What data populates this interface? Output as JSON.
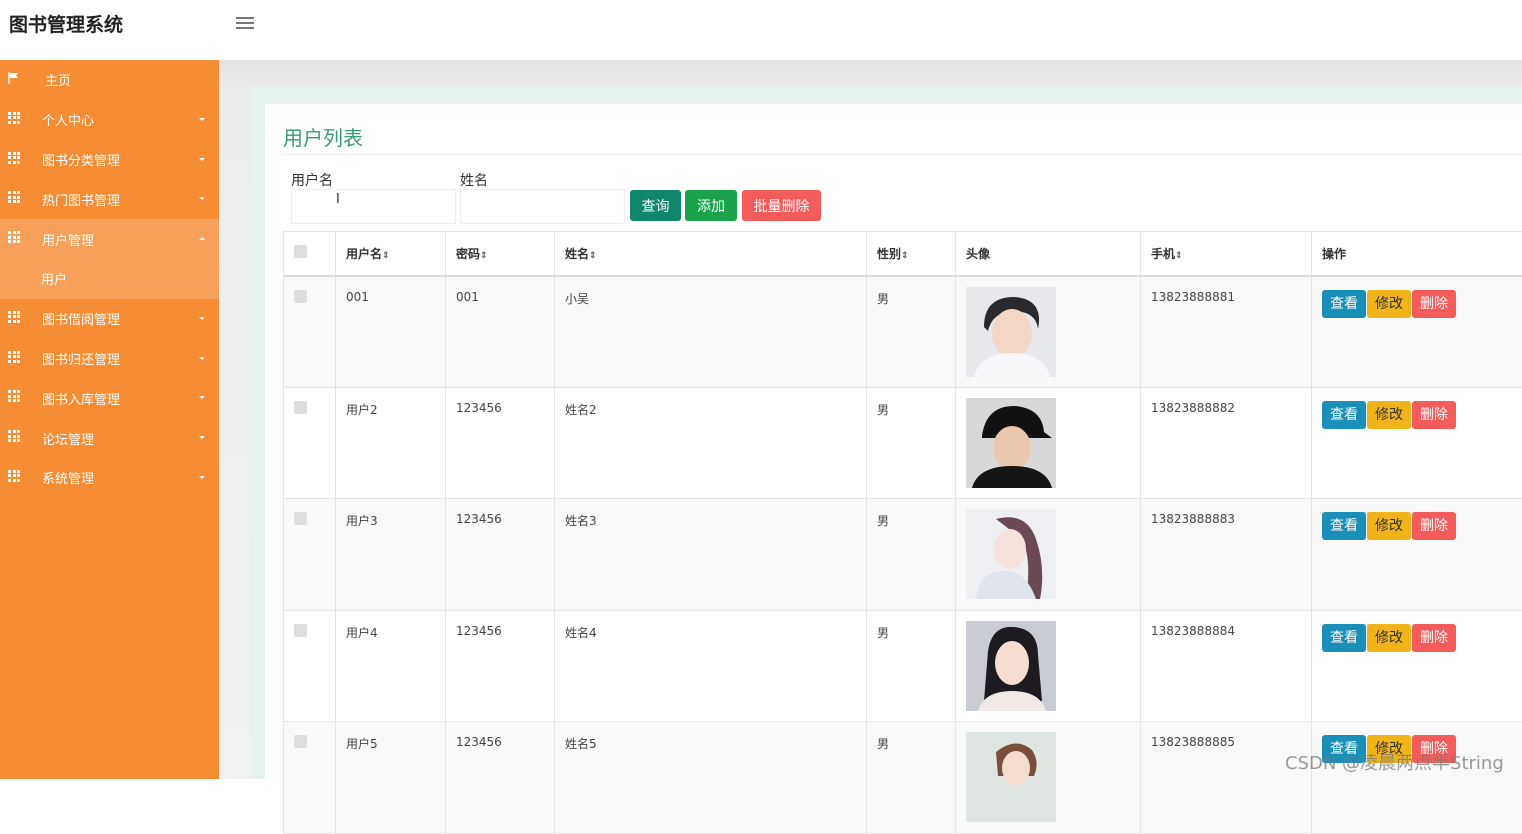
{
  "app": {
    "title": "图书管理系统"
  },
  "sidebar": {
    "items": [
      {
        "label": "主页",
        "icon": "flag-icon"
      },
      {
        "label": "个人中心",
        "icon": "grid-icon"
      },
      {
        "label": "图书分类管理",
        "icon": "grid-icon"
      },
      {
        "label": "热门图书管理",
        "icon": "grid-icon"
      },
      {
        "label": "用户管理",
        "icon": "grid-icon",
        "expanded": true
      },
      {
        "label": "图书借阅管理",
        "icon": "grid-icon"
      },
      {
        "label": "图书归还管理",
        "icon": "grid-icon"
      },
      {
        "label": "图书入库管理",
        "icon": "grid-icon"
      },
      {
        "label": "论坛管理",
        "icon": "grid-icon"
      },
      {
        "label": "系统管理",
        "icon": "grid-icon"
      }
    ],
    "sub_item": "用户"
  },
  "page": {
    "title": "用户列表"
  },
  "search": {
    "username_label": "用户名",
    "username_value": "",
    "name_label": "姓名",
    "name_value": "",
    "query_label": "查询",
    "add_label": "添加",
    "batch_delete_label": "批量删除"
  },
  "table": {
    "headers": [
      "用户名",
      "密码",
      "姓名",
      "性别",
      "头像",
      "手机",
      "操作"
    ],
    "rows": [
      {
        "username": "001",
        "password": "001",
        "name": "小吴",
        "gender": "男",
        "phone": "13823888881"
      },
      {
        "username": "用户2",
        "password": "123456",
        "name": "姓名2",
        "gender": "男",
        "phone": "13823888882"
      },
      {
        "username": "用户3",
        "password": "123456",
        "name": "姓名3",
        "gender": "男",
        "phone": "13823888883"
      },
      {
        "username": "用户4",
        "password": "123456",
        "name": "姓名4",
        "gender": "男",
        "phone": "13823888884"
      },
      {
        "username": "用户5",
        "password": "123456",
        "name": "姓名5",
        "gender": "男",
        "phone": "13823888885"
      }
    ],
    "actions": {
      "view": "查看",
      "edit": "修改",
      "delete": "删除"
    }
  },
  "watermark": "CSDN @凌晨两点半String",
  "colors": {
    "sidebar": "#f68c34",
    "accent": "#3a9a76",
    "query": "#10866a",
    "add": "#1aa34a",
    "danger": "#f45c5c",
    "view": "#1a8fb8",
    "edit": "#f0b31a"
  }
}
